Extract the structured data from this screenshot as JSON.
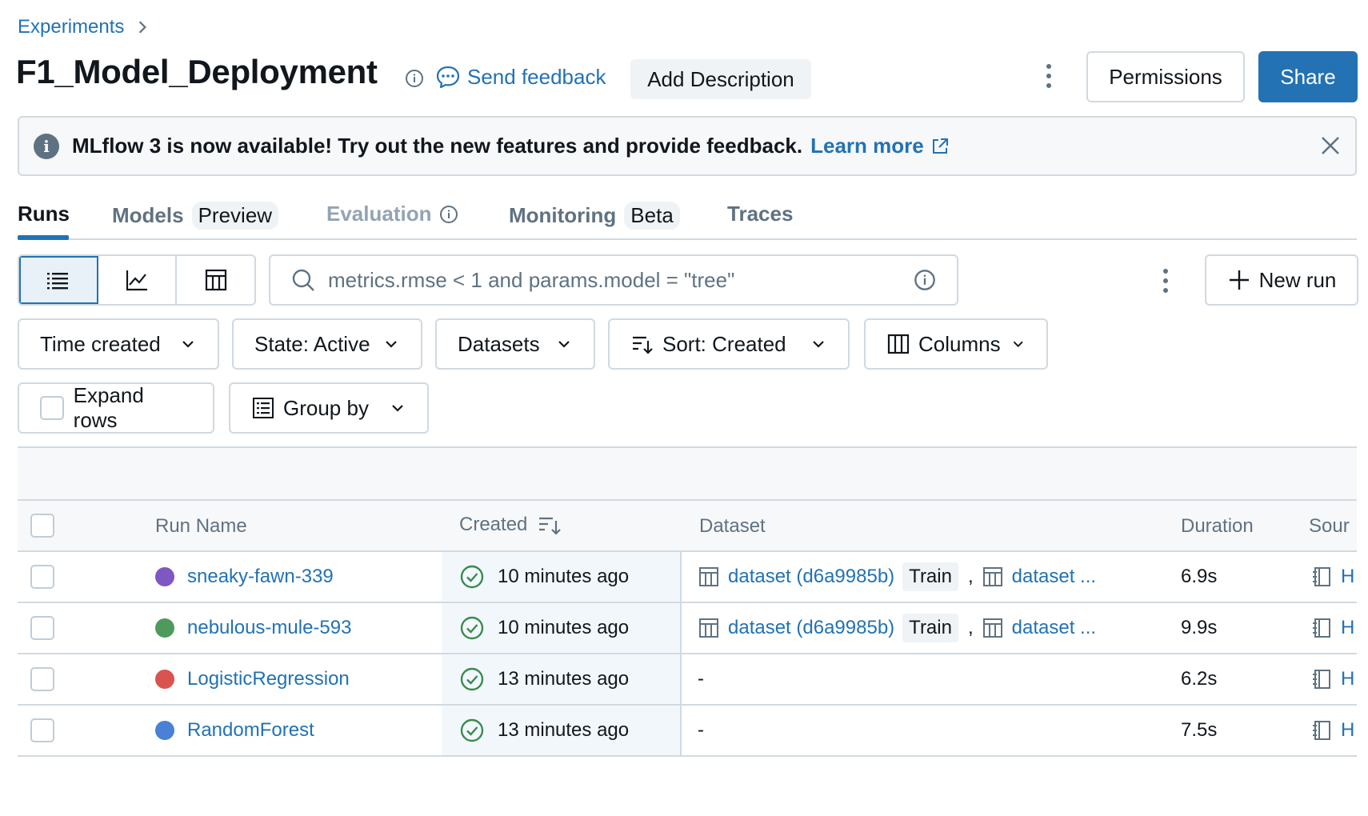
{
  "breadcrumb": {
    "experiments": "Experiments"
  },
  "header": {
    "title": "F1_Model_Deployment",
    "send_feedback": "Send feedback",
    "add_description": "Add Description",
    "permissions": "Permissions",
    "share": "Share"
  },
  "banner": {
    "message": "MLflow 3 is now available! Try out the new features and provide feedback.",
    "learn_more": "Learn more"
  },
  "tabs": [
    {
      "label": "Runs",
      "badge": "",
      "state": "active"
    },
    {
      "label": "Models",
      "badge": "Preview",
      "state": "normal"
    },
    {
      "label": "Evaluation",
      "badge": "",
      "state": "disabled"
    },
    {
      "label": "Monitoring",
      "badge": "Beta",
      "state": "normal"
    },
    {
      "label": "Traces",
      "badge": "",
      "state": "normal"
    }
  ],
  "toolbar": {
    "search_placeholder": "metrics.rmse < 1 and params.model = \"tree\"",
    "new_run": "New run",
    "view_modes": [
      "list-view",
      "chart-view",
      "table-view"
    ],
    "selected_view": "list-view"
  },
  "filters": {
    "time_created": "Time created",
    "state": "State: Active",
    "datasets": "Datasets",
    "sort": "Sort: Created",
    "columns": "Columns",
    "expand_rows": "Expand rows",
    "group_by": "Group by"
  },
  "table": {
    "columns": {
      "run_name": "Run Name",
      "created": "Created",
      "dataset": "Dataset",
      "duration": "Duration",
      "source": "Sour"
    },
    "rows": [
      {
        "name": "sneaky-fawn-339",
        "color": "#7e57c2",
        "created": "10 minutes ago",
        "dataset": "dataset (d6a9985b)",
        "dataset_tag": "Train",
        "dataset_more": "dataset ...",
        "duration": "6.9s",
        "source": "H"
      },
      {
        "name": "nebulous-mule-593",
        "color": "#4e9a5c",
        "created": "10 minutes ago",
        "dataset": "dataset (d6a9985b)",
        "dataset_tag": "Train",
        "dataset_more": "dataset ...",
        "duration": "9.9s",
        "source": "H"
      },
      {
        "name": "LogisticRegression",
        "color": "#d9534f",
        "created": "13 minutes ago",
        "dataset": "",
        "dataset_empty": "-",
        "duration": "6.2s",
        "source": "H"
      },
      {
        "name": "RandomForest",
        "color": "#4a80d6",
        "created": "13 minutes ago",
        "dataset": "",
        "dataset_empty": "-",
        "duration": "7.5s",
        "source": "H"
      }
    ]
  },
  "colors": {
    "accent": "#2272b4",
    "success": "#3b8a4e",
    "border": "#d1d9e1",
    "muted": "#5f7281"
  }
}
